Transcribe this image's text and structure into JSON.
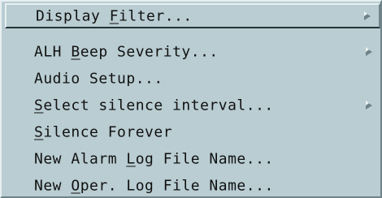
{
  "menu": {
    "items": [
      {
        "before": "Display ",
        "mnemonic": "F",
        "after": "ilter...",
        "submenu": true,
        "selected": true
      },
      {
        "before": "ALH ",
        "mnemonic": "B",
        "after": "eep Severity...",
        "submenu": true
      },
      {
        "before": "Audio Setup...",
        "mnemonic": "",
        "after": "",
        "submenu": false
      },
      {
        "before": "",
        "mnemonic": "S",
        "after": "elect silence interval...",
        "submenu": true
      },
      {
        "before": "",
        "mnemonic": "S",
        "after": "ilence Forever",
        "submenu": false
      },
      {
        "before": "New Alarm ",
        "mnemonic": "L",
        "after": "og File Name...",
        "submenu": false
      },
      {
        "before": "New ",
        "mnemonic": "O",
        "after": "per. Log File Name...",
        "submenu": false
      }
    ]
  },
  "colors": {
    "menu_bg": "#b9cdd2",
    "highlight": "#e7eff1",
    "shadow": "#6f8489",
    "text": "#111111"
  },
  "icons": {
    "submenu": "submenu-arrow-icon"
  }
}
